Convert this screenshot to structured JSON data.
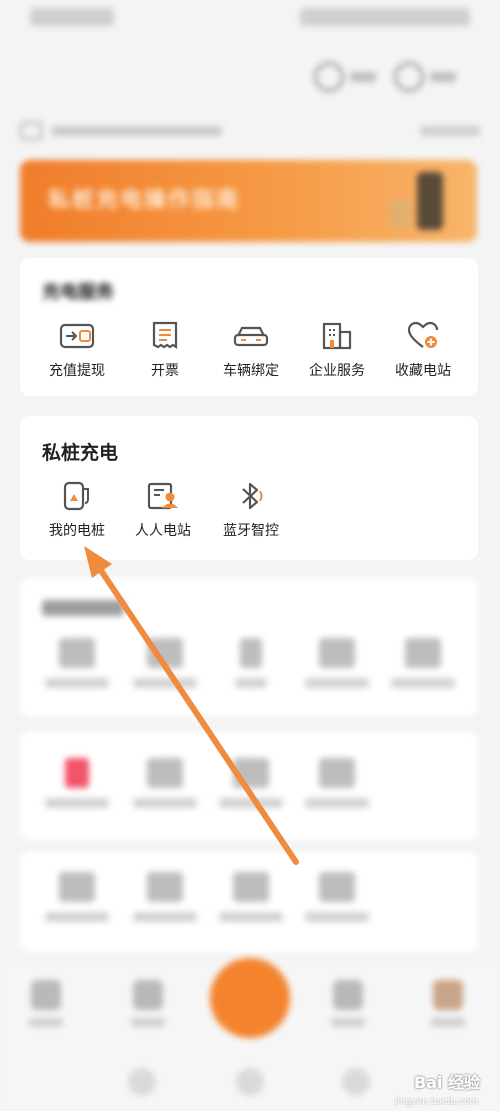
{
  "banner": {
    "text": "私桩充电操作指南"
  },
  "wallet_section": {
    "title": "充电服务",
    "items": [
      {
        "label": "充值提现",
        "icon": "wallet-icon"
      },
      {
        "label": "开票",
        "icon": "invoice-icon"
      },
      {
        "label": "车辆绑定",
        "icon": "car-icon"
      },
      {
        "label": "企业服务",
        "icon": "building-icon"
      },
      {
        "label": "收藏电站",
        "icon": "heart-plus-icon"
      }
    ]
  },
  "private_section": {
    "title": "私桩充电",
    "items": [
      {
        "label": "我的电桩",
        "icon": "charger-icon"
      },
      {
        "label": "人人电站",
        "icon": "person-card-icon"
      },
      {
        "label": "蓝牙智控",
        "icon": "bluetooth-icon"
      }
    ]
  },
  "watermark": {
    "brand": "Bai 经验",
    "url": "jingyan.baidu.com"
  },
  "colors": {
    "accent": "#f4832e",
    "arrow": "#f08a3c",
    "banner_start": "#f07c2a",
    "icon_stroke": "#555555"
  }
}
